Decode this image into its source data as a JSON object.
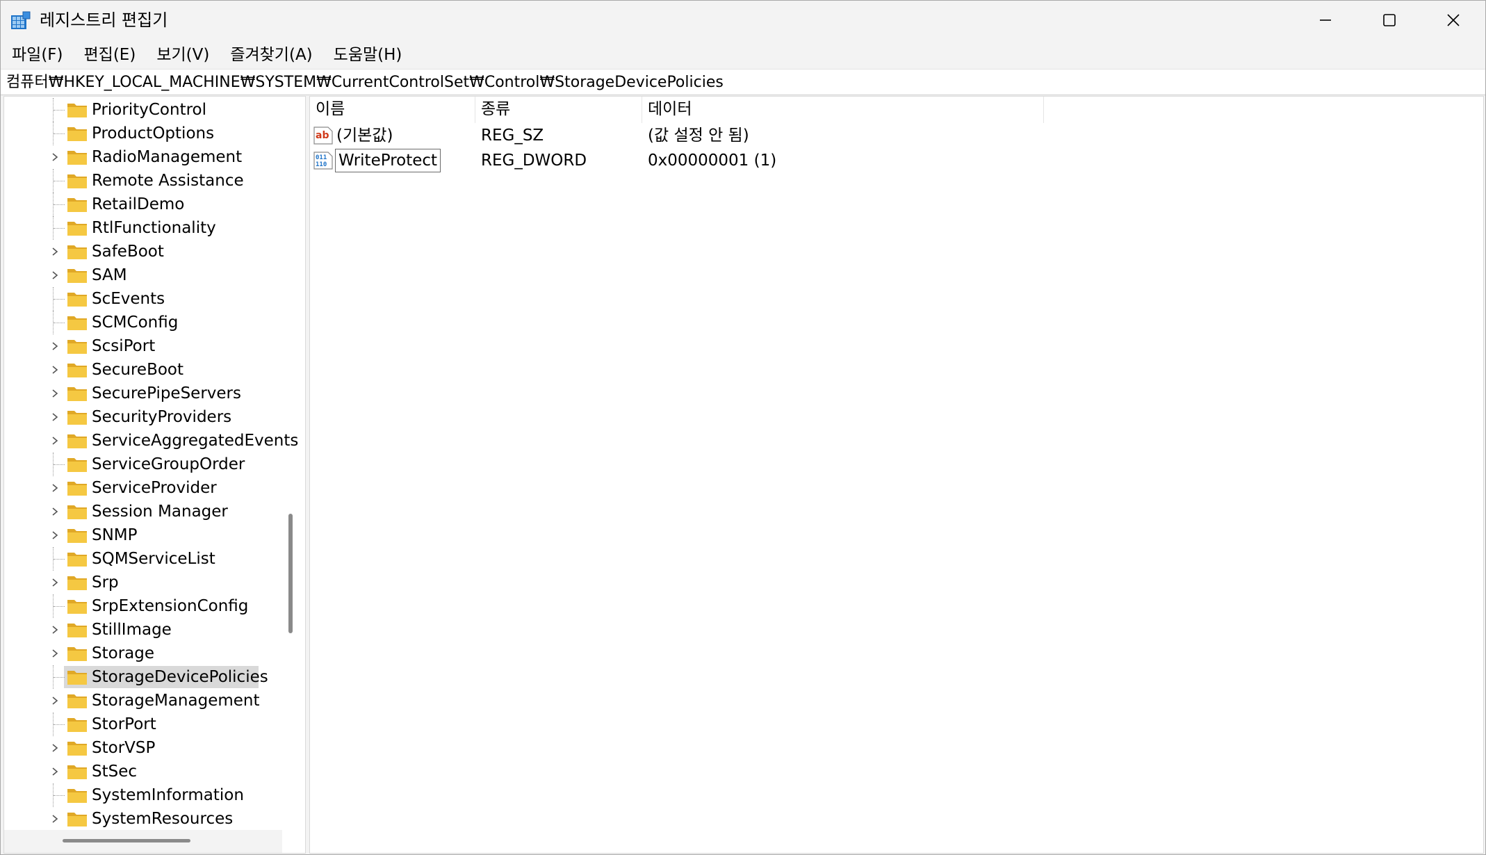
{
  "window": {
    "title": "레지스트리 편집기",
    "icons": [
      "registry-editor-icon",
      "minimize-icon",
      "maximize-icon",
      "close-icon"
    ]
  },
  "menu": [
    "파일(F)",
    "편집(E)",
    "보기(V)",
    "즐겨찾기(A)",
    "도움말(H)"
  ],
  "address": "컴퓨터₩HKEY_LOCAL_MACHINE₩SYSTEM₩CurrentControlSet₩Control₩StorageDevicePolicies",
  "tree": {
    "items": [
      {
        "label": "PriorityControl",
        "expandable": false
      },
      {
        "label": "ProductOptions",
        "expandable": false
      },
      {
        "label": "RadioManagement",
        "expandable": true
      },
      {
        "label": "Remote Assistance",
        "expandable": false
      },
      {
        "label": "RetailDemo",
        "expandable": false
      },
      {
        "label": "RtlFunctionality",
        "expandable": false
      },
      {
        "label": "SafeBoot",
        "expandable": true
      },
      {
        "label": "SAM",
        "expandable": true
      },
      {
        "label": "ScEvents",
        "expandable": false
      },
      {
        "label": "SCMConfig",
        "expandable": false
      },
      {
        "label": "ScsiPort",
        "expandable": true
      },
      {
        "label": "SecureBoot",
        "expandable": true
      },
      {
        "label": "SecurePipeServers",
        "expandable": true
      },
      {
        "label": "SecurityProviders",
        "expandable": true
      },
      {
        "label": "ServiceAggregatedEvents",
        "expandable": true
      },
      {
        "label": "ServiceGroupOrder",
        "expandable": false
      },
      {
        "label": "ServiceProvider",
        "expandable": true
      },
      {
        "label": "Session Manager",
        "expandable": true
      },
      {
        "label": "SNMP",
        "expandable": true
      },
      {
        "label": "SQMServiceList",
        "expandable": false
      },
      {
        "label": "Srp",
        "expandable": true
      },
      {
        "label": "SrpExtensionConfig",
        "expandable": false
      },
      {
        "label": "StillImage",
        "expandable": true
      },
      {
        "label": "Storage",
        "expandable": true
      },
      {
        "label": "StorageDevicePolicies",
        "expandable": false,
        "selected": true
      },
      {
        "label": "StorageManagement",
        "expandable": true
      },
      {
        "label": "StorPort",
        "expandable": false
      },
      {
        "label": "StorVSP",
        "expandable": true
      },
      {
        "label": "StSec",
        "expandable": true
      },
      {
        "label": "SystemInformation",
        "expandable": false
      },
      {
        "label": "SystemResources",
        "expandable": true
      }
    ]
  },
  "list": {
    "columns": {
      "name": "이름",
      "type": "종류",
      "data": "데이터"
    },
    "rows": [
      {
        "name": "(기본값)",
        "type": "REG_SZ",
        "data": "(값 설정 안 됨)",
        "icon": "string-value-icon",
        "focused": false
      },
      {
        "name": "WriteProtect",
        "type": "REG_DWORD",
        "data": "0x00000001 (1)",
        "icon": "binary-value-icon",
        "focused": true
      }
    ]
  },
  "colors": {
    "folder": "#f5c842",
    "folder_dark": "#e0a826",
    "selected": "#d9d9d9",
    "icon_blue": "#1e73c8"
  }
}
